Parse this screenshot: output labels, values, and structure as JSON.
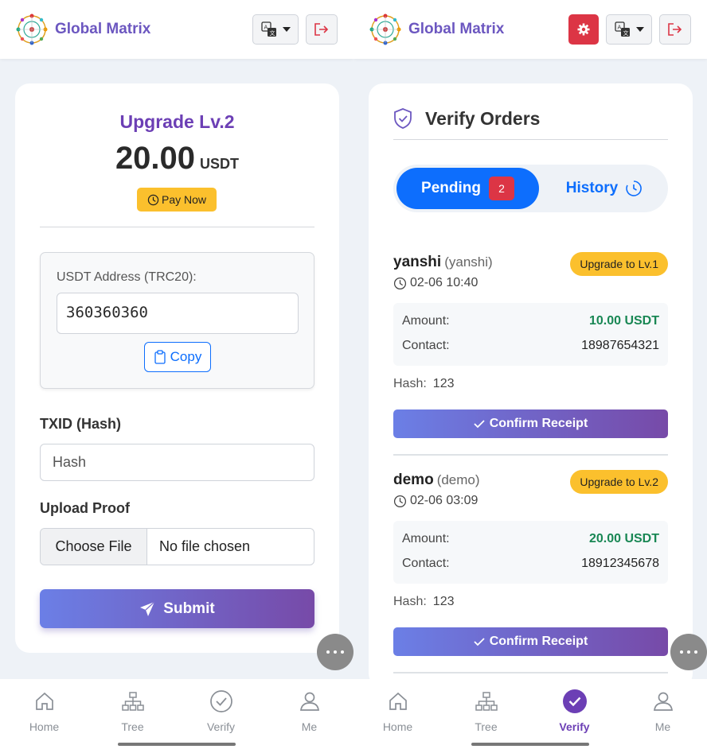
{
  "app": {
    "brand": "Global Matrix"
  },
  "upgrade": {
    "title": "Upgrade Lv.2",
    "amount": "20.00",
    "unit": "USDT",
    "pay_now": "Pay Now",
    "address_label": "USDT Address (TRC20):",
    "address_value": "360360360",
    "copy_label": "Copy",
    "txid_label": "TXID (Hash)",
    "txid_placeholder": "Hash",
    "upload_label": "Upload Proof",
    "choose_file": "Choose File",
    "no_file": "No file chosen",
    "submit_label": "Submit"
  },
  "verify": {
    "title": "Verify Orders",
    "tab_pending": "Pending",
    "pending_count": "2",
    "tab_history": "History",
    "amount_label": "Amount:",
    "contact_label": "Contact:",
    "hash_label": "Hash:",
    "confirm_label": "Confirm Receipt",
    "orders": [
      {
        "name": "yanshi",
        "uid": "(yanshi)",
        "time": "02-06 10:40",
        "badge": "Upgrade to Lv.1",
        "amount": "10.00 USDT",
        "contact": "18987654321",
        "hash": "123"
      },
      {
        "name": "demo",
        "uid": "(demo)",
        "time": "02-06 03:09",
        "badge": "Upgrade to Lv.2",
        "amount": "20.00 USDT",
        "contact": "18912345678",
        "hash": "123"
      }
    ]
  },
  "nav": {
    "items": [
      "Home",
      "Tree",
      "Verify",
      "Me"
    ]
  },
  "colors": {
    "brand": "#6c57c0",
    "primary": "#0d6efd",
    "warning": "#fbc02d",
    "danger": "#dc3545",
    "success": "#198754"
  }
}
